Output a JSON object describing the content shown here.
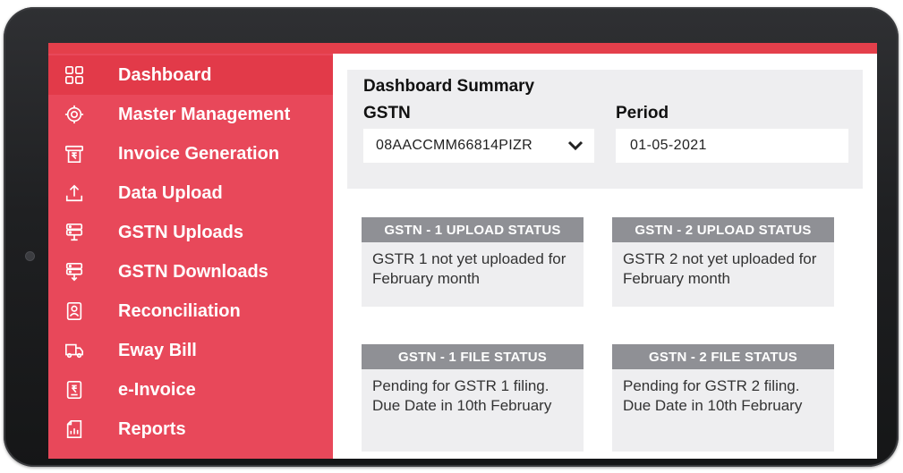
{
  "sidebar": {
    "items": [
      {
        "label": "Dashboard",
        "icon": "grid-icon",
        "active": true
      },
      {
        "label": "Master Management",
        "icon": "target-icon"
      },
      {
        "label": "Invoice Generation",
        "icon": "rupee-invoice-icon"
      },
      {
        "label": "Data Upload",
        "icon": "upload-icon"
      },
      {
        "label": "GSTN Uploads",
        "icon": "server-icon"
      },
      {
        "label": "GSTN Downloads",
        "icon": "server-download-icon"
      },
      {
        "label": "Reconciliation",
        "icon": "document-user-icon"
      },
      {
        "label": "Eway Bill",
        "icon": "truck-icon"
      },
      {
        "label": "e-Invoice",
        "icon": "rupee-receipt-icon"
      },
      {
        "label": "Reports",
        "icon": "report-chart-icon"
      }
    ]
  },
  "summary": {
    "title": "Dashboard Summary",
    "gstn_label": "GSTN",
    "gstn_value": "08AACCMM66814PIZR",
    "period_label": "Period",
    "period_value": "01-05-2021"
  },
  "status_cards": [
    {
      "header": "GSTN - 1 UPLOAD STATUS",
      "body": "GSTR 1 not yet uploaded for February month"
    },
    {
      "header": "GSTN - 2 UPLOAD STATUS",
      "body": "GSTR 2 not yet uploaded for February month"
    },
    {
      "header": "GSTN - 1 FILE STATUS",
      "body": "Pending for GSTR 1 filing. Due Date in 10th February"
    },
    {
      "header": "GSTN - 2 FILE STATUS",
      "body": "Pending for GSTR 2 filing. Due Date in 10th February"
    }
  ],
  "colors": {
    "sidebar": "#e8485a",
    "sidebar_active": "#e23a49",
    "status_header": "#8f9095",
    "card_bg": "#eeeef0"
  }
}
